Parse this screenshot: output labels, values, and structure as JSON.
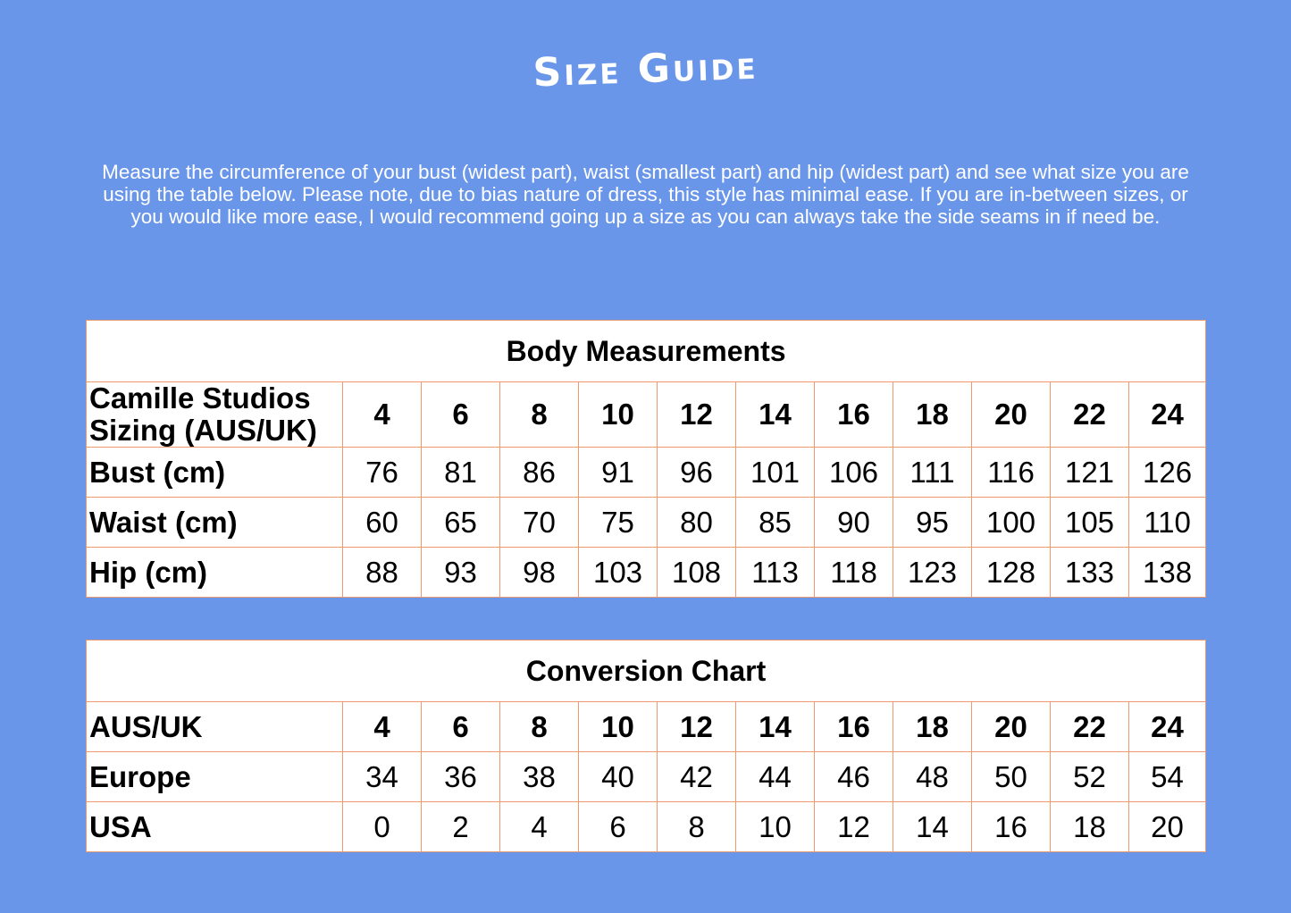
{
  "title": "Size Guide",
  "intro": "Measure the circumference of your bust (widest part), waist (smallest part) and hip (widest part) and see what size you are using the table below. Please note, due to bias nature of dress, this style has minimal ease. If you are in-between sizes, or you would like more ease, I would recommend going up a size as you can always take the side seams in if need be.",
  "colors": {
    "background": "#6a96ea",
    "table_border": "#ee9a6e",
    "table_bg": "#ffffff",
    "text_light": "#ffffff"
  },
  "body_measurements": {
    "caption": "Body Measurements",
    "header_label_line1": "Camille Studios",
    "header_label_line2": "Sizing (AUS/UK)",
    "sizes": [
      "4",
      "6",
      "8",
      "10",
      "12",
      "14",
      "16",
      "18",
      "20",
      "22",
      "24"
    ],
    "rows": [
      {
        "label": "Bust (cm)",
        "values": [
          "76",
          "81",
          "86",
          "91",
          "96",
          "101",
          "106",
          "111",
          "116",
          "121",
          "126"
        ]
      },
      {
        "label": "Waist (cm)",
        "values": [
          "60",
          "65",
          "70",
          "75",
          "80",
          "85",
          "90",
          "95",
          "100",
          "105",
          "110"
        ]
      },
      {
        "label": "Hip (cm)",
        "values": [
          "88",
          "93",
          "98",
          "103",
          "108",
          "113",
          "118",
          "123",
          "128",
          "133",
          "138"
        ]
      }
    ]
  },
  "conversion_chart": {
    "caption": "Conversion Chart",
    "header_label": "AUS/UK",
    "sizes": [
      "4",
      "6",
      "8",
      "10",
      "12",
      "14",
      "16",
      "18",
      "20",
      "22",
      "24"
    ],
    "rows": [
      {
        "label": "Europe",
        "values": [
          "34",
          "36",
          "38",
          "40",
          "42",
          "44",
          "46",
          "48",
          "50",
          "52",
          "54"
        ]
      },
      {
        "label": "USA",
        "values": [
          "0",
          "2",
          "4",
          "6",
          "8",
          "10",
          "12",
          "14",
          "16",
          "18",
          "20"
        ]
      }
    ]
  }
}
